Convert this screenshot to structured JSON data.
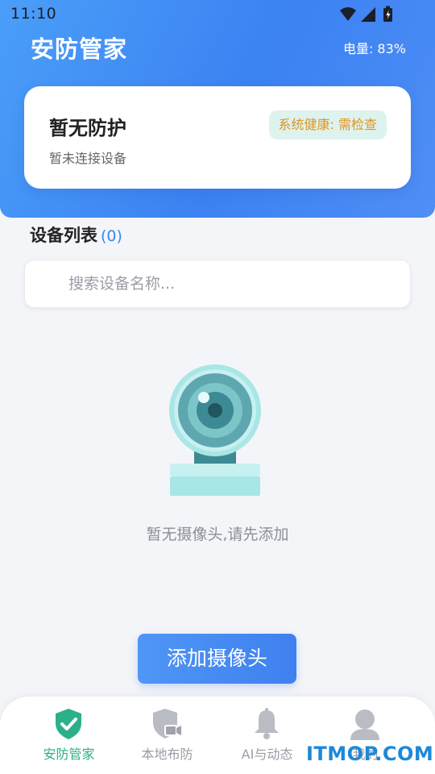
{
  "status_bar": {
    "time": "11:10"
  },
  "header": {
    "app_title": "安防管家",
    "battery_label": "电量: 83%"
  },
  "status_card": {
    "title": "暂无防护",
    "subtitle": "暂未连接设备",
    "health_badge": "系统健康: 需检查"
  },
  "device_list": {
    "title": "设备列表",
    "count": "(0)"
  },
  "search": {
    "placeholder": "搜索设备名称...",
    "value": ""
  },
  "empty_state": {
    "text": "暂无摄像头,请先添加"
  },
  "add_button": {
    "label": "添加摄像头"
  },
  "tabs": [
    {
      "label": "安防管家",
      "icon": "shield-check-icon",
      "active": true
    },
    {
      "label": "本地布防",
      "icon": "shield-camera-icon",
      "active": false
    },
    {
      "label": "AI与动态",
      "icon": "bell-icon",
      "active": false
    },
    {
      "label": "我的",
      "icon": "user-icon",
      "active": false
    }
  ],
  "watermark": "ITMOP.COM",
  "colors": {
    "header_gradient_start": "#4a9ef8",
    "header_gradient_end": "#3b82f2",
    "accent_blue": "#3d84ee",
    "active_tab_green": "#2bb08a",
    "badge_text_orange": "#e09420",
    "badge_bg": "#dff3ee"
  }
}
